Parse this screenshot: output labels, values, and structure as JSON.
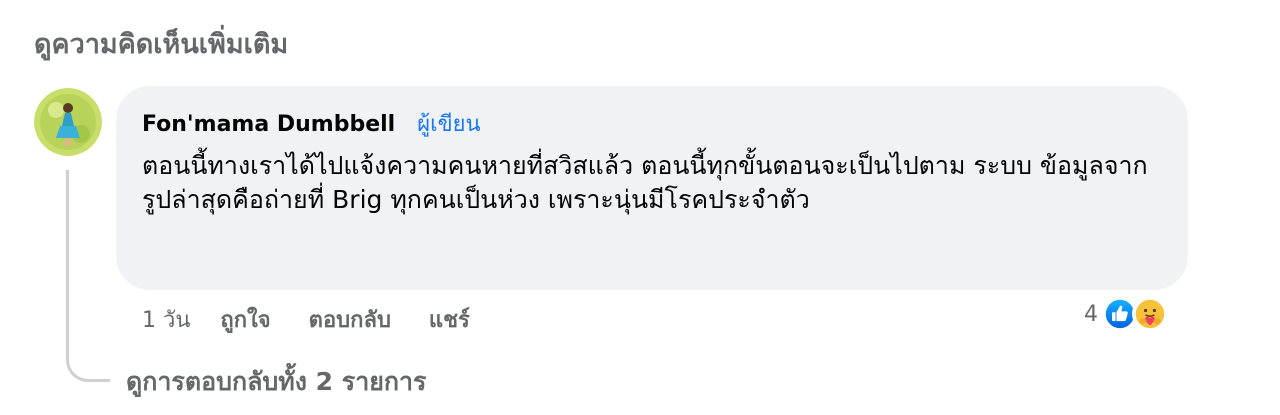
{
  "more_comments_label": "ดูความคิดเห็นเพิ่มเติม",
  "comment": {
    "author": "Fon'mama Dumbbell",
    "author_badge": "ผู้เขียน",
    "text": "ตอนนี้ทางเราได้ไปแจ้งความคนหายที่สวิสแล้ว ตอนนี้ทุกขั้นตอนจะเป็นไปตาม ระบบ ข้อมูลจากรูปล่าสุดคือถ่ายที่ Brig ทุกคนเป็นห่วง เพราะนุ่นมีโรคประจำตัว",
    "timestamp": "1 วัน",
    "actions": {
      "like": "ถูกใจ",
      "reply": "ตอบกลับ",
      "share": "แชร์"
    },
    "reaction_count": "4",
    "reaction_icons": [
      "like-icon",
      "care-icon"
    ]
  },
  "view_replies_label": "ดูการตอบกลับทั้ง 2 รายการ",
  "colors": {
    "accent": "#1877f2",
    "secondary_text": "#65676b",
    "bubble_bg": "#f0f2f5"
  }
}
